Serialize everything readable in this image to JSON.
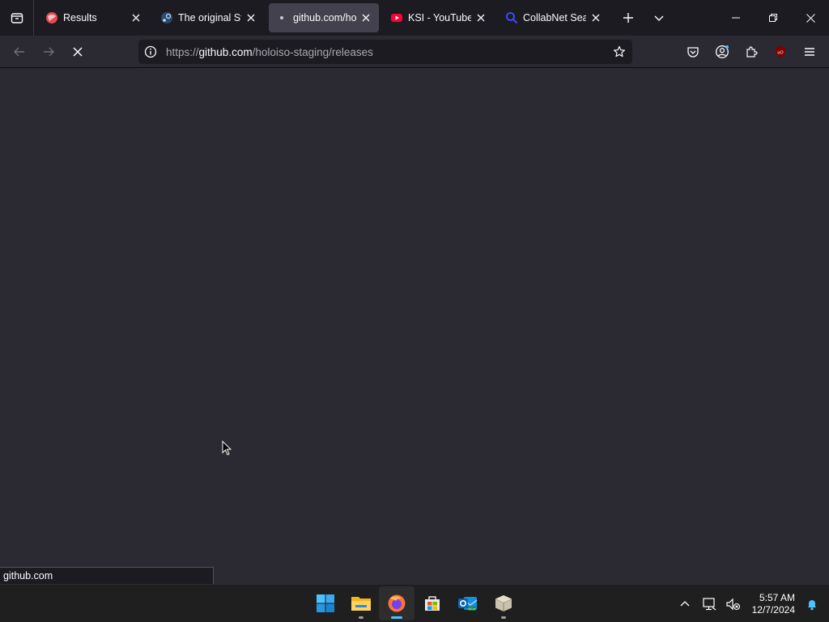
{
  "tabs": [
    {
      "title": "Results",
      "favicon": "red-globe-icon",
      "active": false
    },
    {
      "title": "The original Steam",
      "favicon": "steam-blue-icon",
      "active": false
    },
    {
      "title": "github.com/holoiso",
      "favicon": "loading-dot-icon",
      "active": true
    },
    {
      "title": "KSI - YouTube",
      "favicon": "youtube-icon",
      "active": false
    },
    {
      "title": "CollabNet SearX",
      "favicon": "search-icon",
      "active": false
    }
  ],
  "urlbar": {
    "protocol": "https://",
    "domain": "github.com",
    "path": "/holoiso-staging/releases"
  },
  "status": {
    "text": "github.com"
  },
  "taskbar": {
    "apps": [
      "windows-start-icon",
      "file-explorer-icon",
      "firefox-icon",
      "microsoft-store-icon",
      "outlook-icon",
      "package-icon"
    ],
    "active_app": "firefox-icon",
    "time": "5:57 AM",
    "date": "12/7/2024"
  },
  "colors": {
    "accent": "#4cc2ff",
    "tab_bg": "#1c1b22",
    "content_bg": "#2b2a33",
    "active_tab": "#42414d"
  }
}
